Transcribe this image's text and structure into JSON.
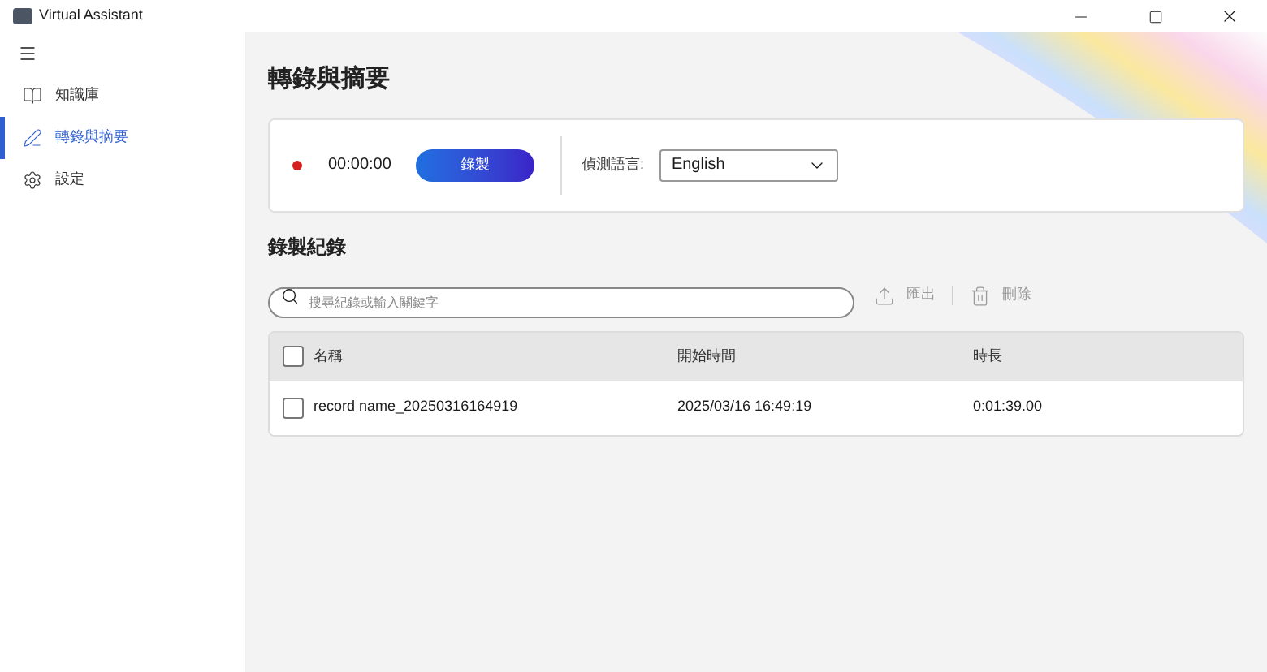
{
  "window": {
    "title": "Virtual Assistant"
  },
  "sidebar": {
    "items": [
      {
        "label": "知識庫",
        "selected": false
      },
      {
        "label": "轉錄與摘要",
        "selected": true
      },
      {
        "label": "設定",
        "selected": false
      }
    ]
  },
  "page_title": "轉錄與摘要",
  "recorder": {
    "time": "00:00:00",
    "record_button": "錄製",
    "language_label": "偵測語言:",
    "language": "English"
  },
  "records": {
    "heading": "錄製紀錄",
    "search": {
      "placeholder": "搜尋紀錄或輸入關鍵字"
    },
    "actions": [
      {
        "label": "匯出",
        "disabled": true
      },
      {
        "label": "刪除",
        "disabled": true
      }
    ],
    "table": {
      "select_all_checked": false,
      "columns": [
        "名稱",
        "開始時間",
        "時長"
      ],
      "rows": [
        {
          "checked": false,
          "cells": [
            "record name_20250316164919",
            "2025/03/16 16:49:19",
            "0:01:39.00"
          ]
        }
      ]
    }
  }
}
